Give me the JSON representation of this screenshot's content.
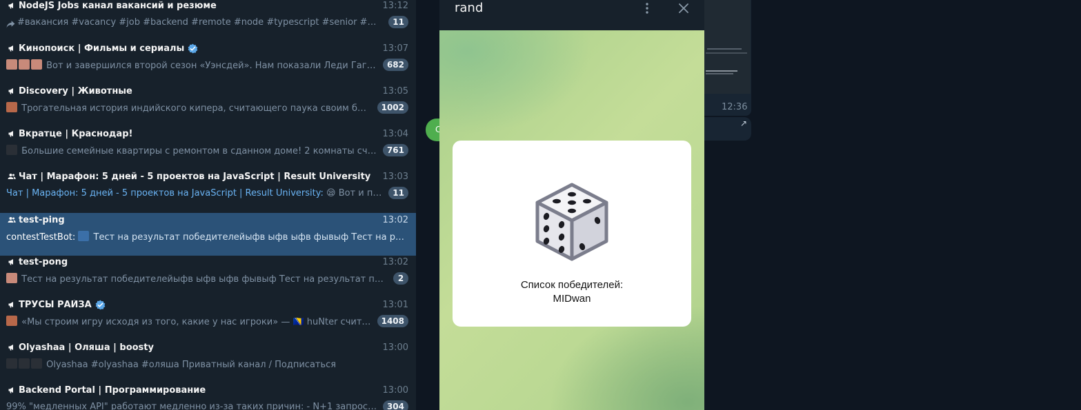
{
  "chats": [
    {
      "type": "channel",
      "name": "NodeJS Jobs канал вакансий и резюме",
      "time": "13:12",
      "preview": "#вакансия #vacancy #job #backend #remote #node #typescript #senior #middle #full...",
      "badge": "11",
      "forwarded": true
    },
    {
      "type": "channel",
      "name": "Кинопоиск | Фильмы и сериалы",
      "verified": true,
      "time": "13:07",
      "preview": "Вот и завершился второй сезон «Уэнсдей». Нам показали Леди Гагу (хоть и...",
      "badge": "682",
      "thumbs": 3
    },
    {
      "type": "channel",
      "name": "Discovery | Животные",
      "time": "13:05",
      "preview": "Трогательная история индийского кипера, считающего паука своим братом.  Di...",
      "badge": "1002",
      "thumbs": 1
    },
    {
      "type": "channel",
      "name": "Вкратце | Краснодар!",
      "time": "13:04",
      "preview": "Большие семейные квартиры с ремонтом в сданном доме!  2 комнаты счастья в ...",
      "badge": "761",
      "thumbs": 1
    },
    {
      "type": "group",
      "name": "Чат | Марафон: 5 дней - 5 проектов на JavaScript | Result University",
      "time": "13:03",
      "sender": "Чат | Марафон: 5 дней - 5 проектов на JavaScript | Result University:",
      "emoji": "😪",
      "preview": "Вот и пришло ...",
      "badge": "11"
    },
    {
      "type": "group",
      "name": "test-ping",
      "time": "13:02",
      "sender": "contestTestBot:",
      "preview": "Тест на результат победителейыфв ыфв ыфв фывыф   Тест на результат...",
      "active": true,
      "thumbs": 1
    },
    {
      "type": "channel",
      "name": "test-pong",
      "time": "13:02",
      "preview": "Тест на результат победителейыфв ыфв ыфв фывыф   Тест на результат победителей",
      "badge": "2",
      "thumbs": 1
    },
    {
      "type": "channel",
      "name": "ТРУСЫ РАЙЗА",
      "verified": true,
      "time": "13:01",
      "preview": "«Мы строим игру исходя из того, какие у нас игроки» — 🇧🇦 huNter считает 🇫🇮 s...",
      "badge": "1408",
      "thumbs": 1
    },
    {
      "type": "channel",
      "name": "Olyashaa | Оляша | boosty",
      "time": "13:00",
      "preview": "Olyashaa #olyashaa #оляша  Приватный канал / Подписаться",
      "thumbs": 3
    },
    {
      "type": "channel",
      "name": "Backend Portal | Программирование",
      "time": "13:00",
      "preview": "99% \"медленных API\" работают медленно из-за таких причин:  - N+1 запросы - нет и...",
      "badge": "304"
    }
  ],
  "background": {
    "message_time": "12:36",
    "green_bubble_letter": "С"
  },
  "popup": {
    "title": "rand",
    "menu_icon": "more-vertical-icon",
    "close_icon": "close-icon",
    "card": {
      "image": "dice-icon",
      "line1": "Список победителей:",
      "line2": "MIDwan"
    }
  },
  "colors": {
    "sidebar_bg": "#17212b",
    "active_bg": "#2b5278",
    "badge_bg": "#3e546a",
    "accent": "#6ab3f3"
  }
}
